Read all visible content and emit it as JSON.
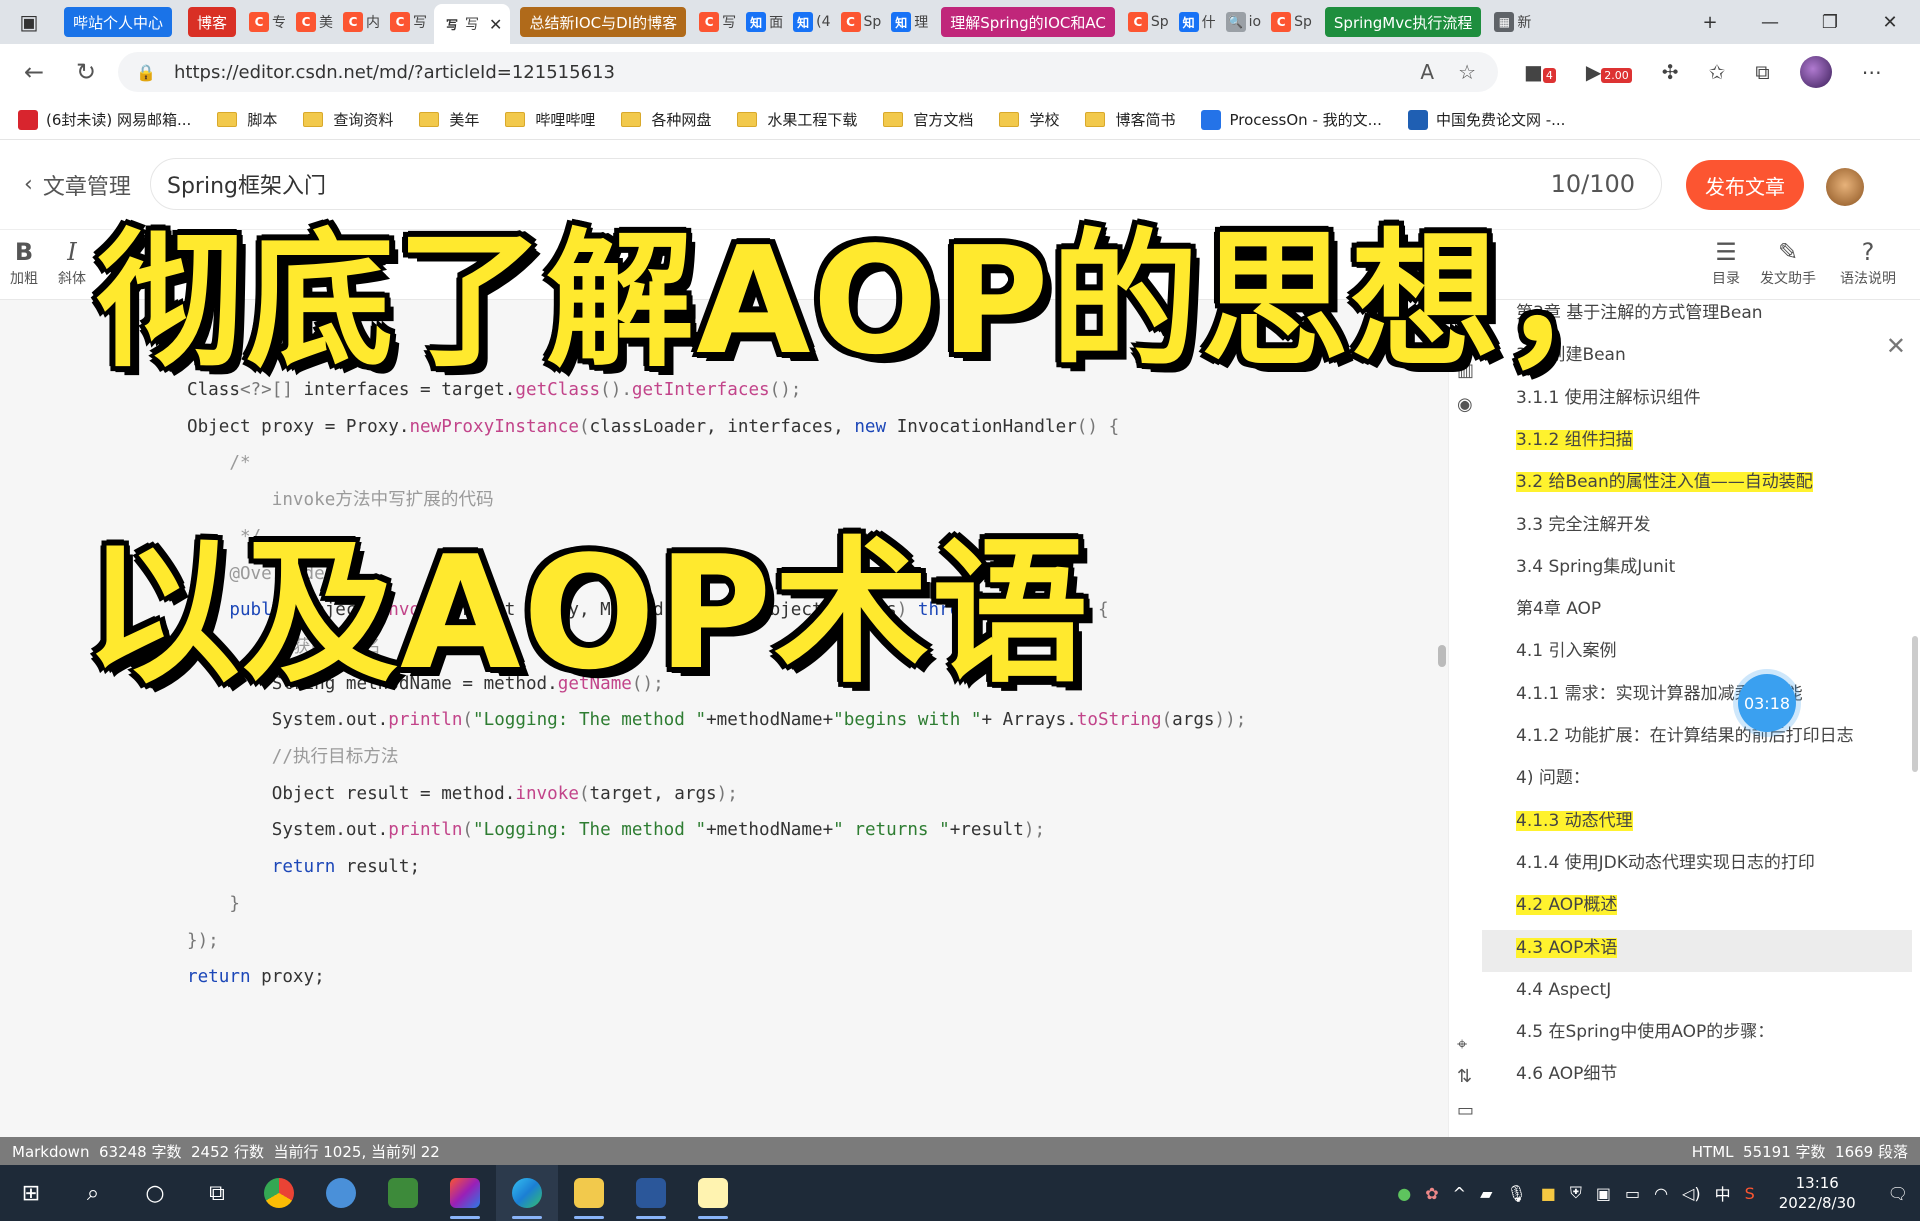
{
  "browser": {
    "tabs": [
      {
        "label": "哔站个人中心",
        "kind": "group",
        "color": "#1a73e8"
      },
      {
        "label": "博客",
        "kind": "group",
        "color": "#d93025"
      },
      {
        "label": "专",
        "kind": "sm",
        "fav": "C",
        "favcolor": "#fc5531"
      },
      {
        "label": "美",
        "kind": "sm",
        "fav": "C",
        "favcolor": "#fc5531"
      },
      {
        "label": "内",
        "kind": "sm",
        "fav": "C",
        "favcolor": "#fc5531"
      },
      {
        "label": "写",
        "kind": "sm",
        "fav": "C",
        "favcolor": "#fc5531"
      },
      {
        "label": "写",
        "kind": "active",
        "fav": "写",
        "favcolor": "#ffffff"
      },
      {
        "label": "总结新IOC与DI的博客",
        "kind": "group",
        "color": "#b06a1a"
      },
      {
        "label": "写",
        "kind": "sm",
        "fav": "C",
        "favcolor": "#fc5531"
      },
      {
        "label": "面",
        "kind": "sm",
        "fav": "知",
        "favcolor": "#1772f6"
      },
      {
        "label": "(4",
        "kind": "sm",
        "fav": "知",
        "favcolor": "#1772f6"
      },
      {
        "label": "Sp",
        "kind": "sm",
        "fav": "C",
        "favcolor": "#fc5531"
      },
      {
        "label": "理",
        "kind": "sm",
        "fav": "知",
        "favcolor": "#1772f6"
      },
      {
        "label": "理解Spring的IOC和AC",
        "kind": "group",
        "color": "#c0267a"
      },
      {
        "label": "Sp",
        "kind": "sm",
        "fav": "C",
        "favcolor": "#fc5531"
      },
      {
        "label": "什",
        "kind": "sm",
        "fav": "知",
        "favcolor": "#1772f6"
      },
      {
        "label": "io",
        "kind": "sm",
        "fav": "🔍",
        "favcolor": "#9aa0a6"
      },
      {
        "label": "Sp",
        "kind": "sm",
        "fav": "C",
        "favcolor": "#fc5531"
      },
      {
        "label": "SpringMvc执行流程",
        "kind": "group",
        "color": "#1e8e3e"
      },
      {
        "label": "新",
        "kind": "sm",
        "fav": "▦",
        "favcolor": "#5f6368"
      }
    ],
    "url": "https://editor.csdn.net/md/?articleId=121515613",
    "ext_badge1": "4",
    "ext_badge2": "2.00",
    "bookmarks": [
      {
        "label": "(6封未读) 网易邮箱...",
        "icon": "netease"
      },
      {
        "label": "脚本",
        "icon": "folder"
      },
      {
        "label": "查询资料",
        "icon": "folder"
      },
      {
        "label": "美年",
        "icon": "folder"
      },
      {
        "label": "哔哩哔哩",
        "icon": "folder"
      },
      {
        "label": "各种网盘",
        "icon": "folder"
      },
      {
        "label": "水果工程下载",
        "icon": "folder"
      },
      {
        "label": "官方文档",
        "icon": "folder"
      },
      {
        "label": "学校",
        "icon": "folder"
      },
      {
        "label": "博客简书",
        "icon": "folder"
      },
      {
        "label": "ProcessOn - 我的文...",
        "icon": "processon"
      },
      {
        "label": "中国免费论文网 -...",
        "icon": "paper"
      }
    ]
  },
  "editor": {
    "back_label": "文章管理",
    "title_value": "Spring框架入门",
    "title_count": "10/100",
    "publish_label": "发布文章",
    "toolbar_left": [
      {
        "icon": "B",
        "label": "加粗"
      },
      {
        "icon": "I",
        "label": "斜体"
      }
    ],
    "toolbar_right": [
      {
        "icon": "☰",
        "label": "目录"
      },
      {
        "icon": "✎",
        "label": "发文助手"
      },
      {
        "icon": "?",
        "label": "语法说明"
      }
    ],
    "code_lines": [
      [
        [
          "",
          "Class"
        ],
        [
          "p",
          "<?>[]"
        ],
        [
          "",
          " interfaces = target."
        ],
        [
          "m",
          "getClass"
        ],
        [
          "p",
          "()."
        ],
        [
          "m",
          "getInterfaces"
        ],
        [
          "p",
          "();"
        ]
      ],
      [
        [
          "",
          "Object proxy = Proxy."
        ],
        [
          "m",
          "newProxyInstance"
        ],
        [
          "p",
          "("
        ],
        [
          "",
          "classLoader, interfaces, "
        ],
        [
          "k",
          "new"
        ],
        [
          "",
          " InvocationHandler"
        ],
        [
          "p",
          "() {"
        ]
      ],
      [
        [
          "c",
          "    /*"
        ]
      ],
      [
        [
          "c",
          "        invoke方法中写扩展的代码"
        ]
      ],
      [
        [
          "c",
          "     */"
        ]
      ],
      [
        [
          "c",
          "    @Override"
        ]
      ],
      [
        [
          "k",
          "    public"
        ],
        [
          "",
          " Object "
        ],
        [
          "m",
          "invoke"
        ],
        [
          "p",
          "("
        ],
        [
          "",
          "Object proxy, Method method, Object"
        ],
        [
          "p",
          "[]"
        ],
        [
          "",
          " args"
        ],
        [
          "p",
          ")"
        ],
        [
          "k",
          " throws"
        ],
        [
          "",
          " Throwable "
        ],
        [
          "p",
          "{"
        ]
      ],
      [
        [
          "c",
          "        //获取方法名"
        ]
      ],
      [
        [
          "",
          "        String methodName = method."
        ],
        [
          "m",
          "getName"
        ],
        [
          "p",
          "();"
        ]
      ],
      [
        [
          "",
          "        System.out."
        ],
        [
          "m",
          "println"
        ],
        [
          "p",
          "("
        ],
        [
          "s",
          "\"Logging: The method \""
        ],
        [
          "",
          "+methodName+"
        ],
        [
          "s",
          "\"begins with \""
        ],
        [
          "",
          "+ Arrays."
        ],
        [
          "m",
          "toString"
        ],
        [
          "p",
          "("
        ],
        [
          "",
          "args"
        ],
        [
          "p",
          "));"
        ]
      ],
      [
        [
          "c",
          "        //执行目标方法"
        ]
      ],
      [
        [
          "",
          "        Object result = method."
        ],
        [
          "m",
          "invoke"
        ],
        [
          "p",
          "("
        ],
        [
          "",
          "target, args"
        ],
        [
          "p",
          ");"
        ]
      ],
      [
        [
          "",
          "        System.out."
        ],
        [
          "m",
          "println"
        ],
        [
          "p",
          "("
        ],
        [
          "s",
          "\"Logging: The method \""
        ],
        [
          "",
          "+methodName+"
        ],
        [
          "s",
          "\" returns \""
        ],
        [
          "",
          "+result"
        ],
        [
          "p",
          ");"
        ]
      ],
      [
        [
          "k",
          "        return"
        ],
        [
          "",
          " result;"
        ]
      ],
      [
        [
          "p",
          "    }"
        ]
      ],
      [
        [
          "p",
          "});"
        ]
      ],
      [
        [
          "k",
          "return"
        ],
        [
          "",
          " proxy;"
        ]
      ]
    ]
  },
  "toc": {
    "items": [
      {
        "label": "第3章 基于注解的方式管理Bean",
        "hl": false
      },
      {
        "label": "3.1 创建Bean",
        "hl": false
      },
      {
        "label": "3.1.1 使用注解标识组件",
        "hl": false
      },
      {
        "label": "3.1.2 组件扫描",
        "hl": true
      },
      {
        "label": "3.2 给Bean的属性注入值——自动装配",
        "hl": true
      },
      {
        "label": "3.3 完全注解开发",
        "hl": false
      },
      {
        "label": "3.4 Spring集成Junit",
        "hl": false
      },
      {
        "label": "第4章 AOP",
        "hl": false
      },
      {
        "label": "4.1 引入案例",
        "hl": false
      },
      {
        "label": "4.1.1 需求：实现计算器加减乘除功能",
        "hl": false
      },
      {
        "label": "4.1.2 功能扩展：在计算结果的前后打印日志",
        "hl": false
      },
      {
        "label": "4) 问题：",
        "hl": false
      },
      {
        "label": "4.1.3 动态代理",
        "hl": true
      },
      {
        "label": "4.1.4 使用JDK动态代理实现日志的打印",
        "hl": false
      },
      {
        "label": "4.2 AOP概述",
        "hl": true
      },
      {
        "label": "4.3 AOP术语",
        "hl": true
      },
      {
        "label": "4.4 AspectJ",
        "hl": false
      },
      {
        "label": "4.5 在Spring中使用AOP的步骤：",
        "hl": false
      },
      {
        "label": "4.6 AOP细节",
        "hl": false
      }
    ],
    "timer": "03:18"
  },
  "statusbar": {
    "left": "Markdown  63248 字数  2452 行数  当前行 1025, 当前列 22",
    "right": "HTML  55191 字数  1669 段落"
  },
  "taskbar": {
    "time": "13:16",
    "date": "2022/8/30",
    "ime": "中"
  },
  "overlay": {
    "line1": "彻底了解AOP的思想，",
    "line2": "以及AOP术语"
  }
}
